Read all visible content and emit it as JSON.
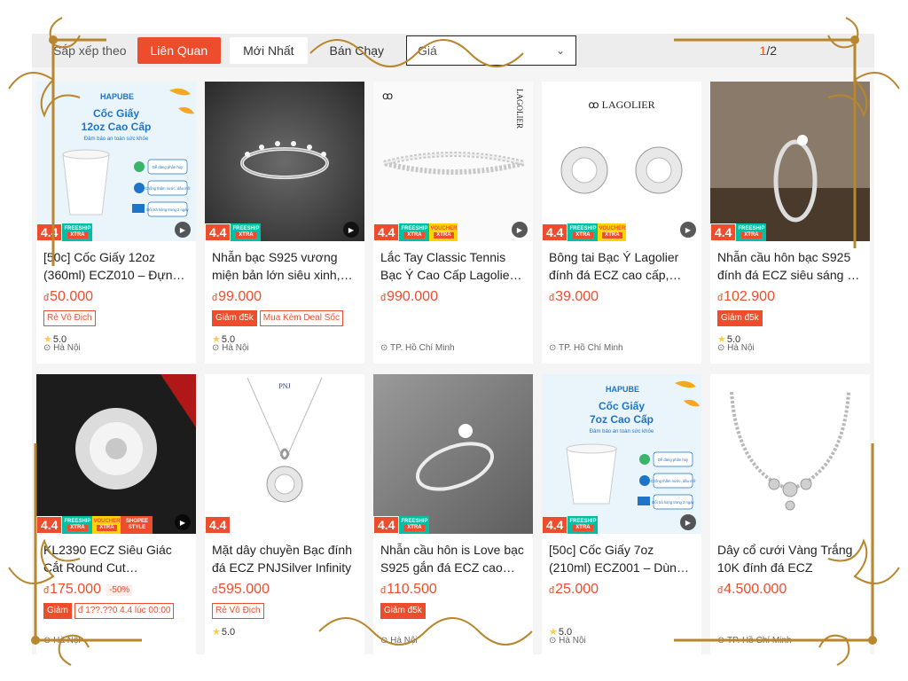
{
  "sort_bar": {
    "label": "Sắp xếp theo",
    "options": [
      "Liên Quan",
      "Mới Nhất",
      "Bán Chạy"
    ],
    "price_select": "Giá",
    "page_current": "1",
    "page_total": "/2"
  },
  "products": [
    {
      "title": "[50c] Cốc Giấy 12oz (360ml) ECZ010 – Đựng Đồ Uống",
      "price": "50.000",
      "tags": [
        "Rẻ Vô Địch"
      ],
      "rating": "5.0",
      "location": "Hà Nội"
    },
    {
      "title": "Nhẫn bạc S925 vương miện bản lớn siêu xinh, gắn đá ECZ",
      "price": "99.000",
      "tags": [
        "Giảm đ5k",
        "Mua Kèm Deal Sốc"
      ],
      "rating": "5.0",
      "location": "Hà Nội"
    },
    {
      "title": "Lắc Tay Classic Tennis Bạc Ý Cao Cấp Lagolier đính đá ECZ",
      "price": "990.000",
      "tags": [],
      "rating": "",
      "location": "TP. Hồ Chí Minh"
    },
    {
      "title": "Bông tai Bạc Ý Lagolier đính đá ECZ cao cấp, sang trọng",
      "price": "39.000",
      "tags": [],
      "rating": "",
      "location": "TP. Hồ Chí Minh"
    },
    {
      "title": "Nhẫn cầu hôn bạc S925 đính đá ECZ siêu sáng - Nhẫn nữ",
      "price": "102.900",
      "tags": [
        "Giảm đ5k"
      ],
      "rating": "5.0",
      "location": "Hà Nội"
    },
    {
      "title": "KL2390 ECZ Siêu Giác Cắt Round Cut Portuguese Cut",
      "price": "175.000",
      "discount": "-50%",
      "tags": [
        "Giảm",
        "đ 1??.??0 4.4 lúc 00:00"
      ],
      "rating": "",
      "location": "Hà Nội"
    },
    {
      "title": "Mặt dây chuyền Bạc đính đá ECZ PNJSilver Infinity",
      "price": "595.000",
      "tags": [
        "Rẻ Vô Địch"
      ],
      "rating": "5.0",
      "location": ""
    },
    {
      "title": "Nhẫn cầu hôn is Love bạc S925 gắn đá ECZ cao cấp",
      "price": "110.500",
      "tags": [
        "Giảm đ5k"
      ],
      "rating": "",
      "location": "Hà Nội"
    },
    {
      "title": "[50c] Cốc Giấy 7oz (210ml) ECZ001 – Dùng Cho Hội Nghị",
      "price": "25.000",
      "tags": [],
      "rating": "5.0",
      "location": "Hà Nội"
    },
    {
      "title": "Dây cổ cưới Vàng Trắng 10K đính đá ECZ",
      "price": "4.500.000",
      "tags": [],
      "rating": "",
      "location": "TP. Hồ Chí Minh"
    }
  ],
  "badges": {
    "sale": "4.4",
    "freeship_top": "FREESHIP",
    "freeship_bottom": "XTRA",
    "voucher_top": "VOUCHER",
    "voucher_bottom": "XTRA",
    "shopee_top": "SHOPEE",
    "shopee_bottom": "STYLE"
  },
  "cup_ad": {
    "brand": "HAPUBE",
    "heading_12": "Cốc Giấy\n12oz Cao Cấp",
    "heading_7": "Cốc Giấy\n7oz Cao Cấp",
    "subtitle": "Đảm bảo an toàn sức khỏe",
    "feature_1": "Dễ dàng phân hủy",
    "feature_2": "Chống thấm nước, dầu mỡ",
    "feature_3": "Đổi trả hàng trong 2 ngày"
  },
  "brands": {
    "lagolier": "LAGOLIER",
    "pnj": "PNJ"
  },
  "currency": "đ",
  "colors": {
    "accent": "#ee4d2d",
    "star": "#ffce3d",
    "frame_gold": "#b8862c"
  }
}
